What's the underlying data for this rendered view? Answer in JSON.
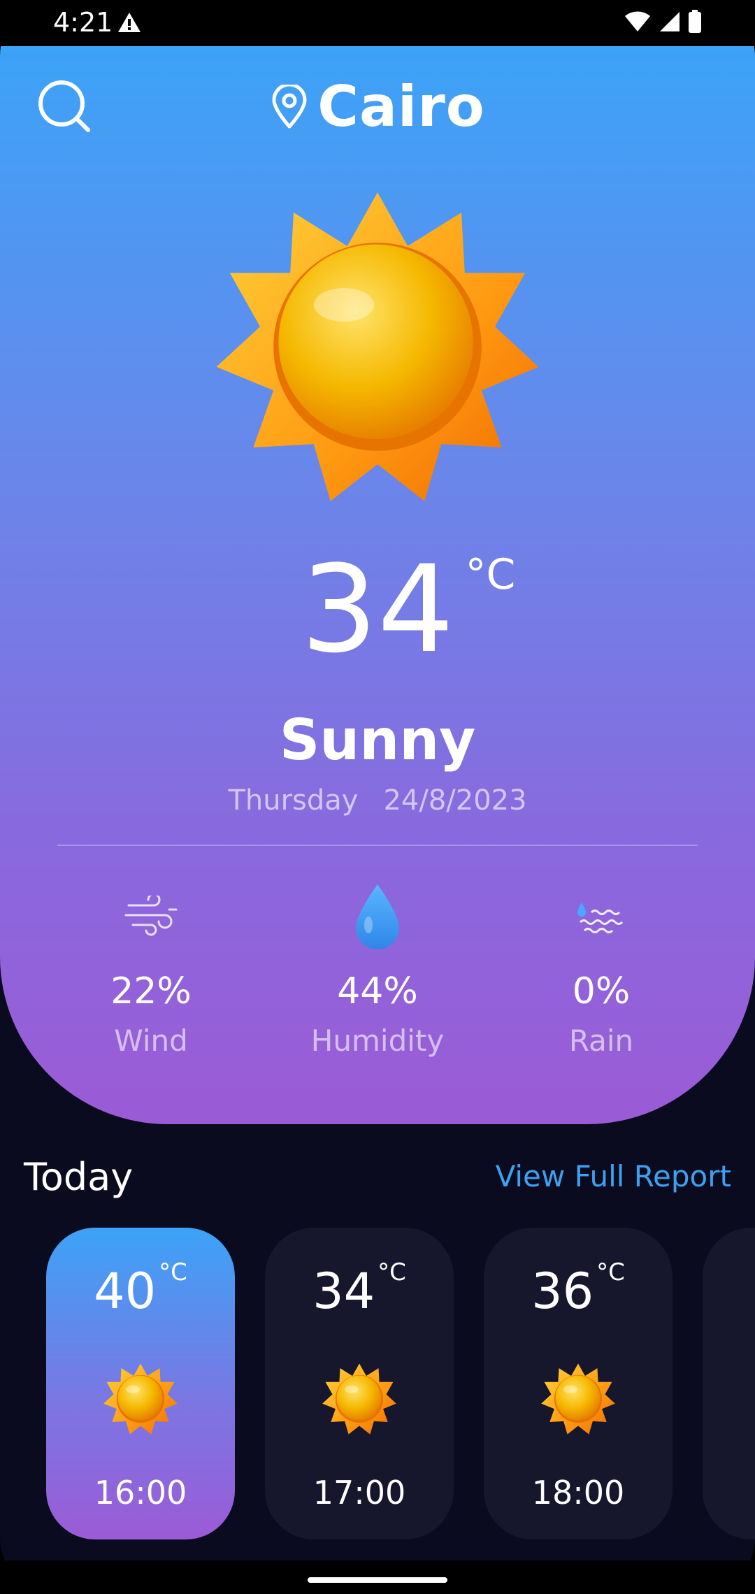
{
  "status_bar": {
    "time": "4:21"
  },
  "header": {
    "city": "Cairo"
  },
  "current": {
    "temperature": "34",
    "unit": "°C",
    "condition": "Sunny",
    "day": "Thursday",
    "date": "24/8/2023"
  },
  "stats": [
    {
      "value": "22%",
      "label": "Wind",
      "icon": "wind-icon"
    },
    {
      "value": "44%",
      "label": "Humidity",
      "icon": "water-drop-icon"
    },
    {
      "value": "0%",
      "label": "Rain",
      "icon": "rain-icon"
    }
  ],
  "today": {
    "title": "Today",
    "link": "View Full Report",
    "hours": [
      {
        "temp": "40",
        "unit": "°C",
        "time": "16:00",
        "icon": "sun-icon",
        "active": true
      },
      {
        "temp": "34",
        "unit": "°C",
        "time": "17:00",
        "icon": "sun-icon",
        "active": false
      },
      {
        "temp": "36",
        "unit": "°C",
        "time": "18:00",
        "icon": "sun-icon",
        "active": false
      }
    ]
  },
  "colors": {
    "gradient_top": "#3ca3f7",
    "gradient_bottom": "#9b5bd6",
    "background": "#0b0b1f",
    "card": "#16162c",
    "link": "#3ea0f0"
  }
}
